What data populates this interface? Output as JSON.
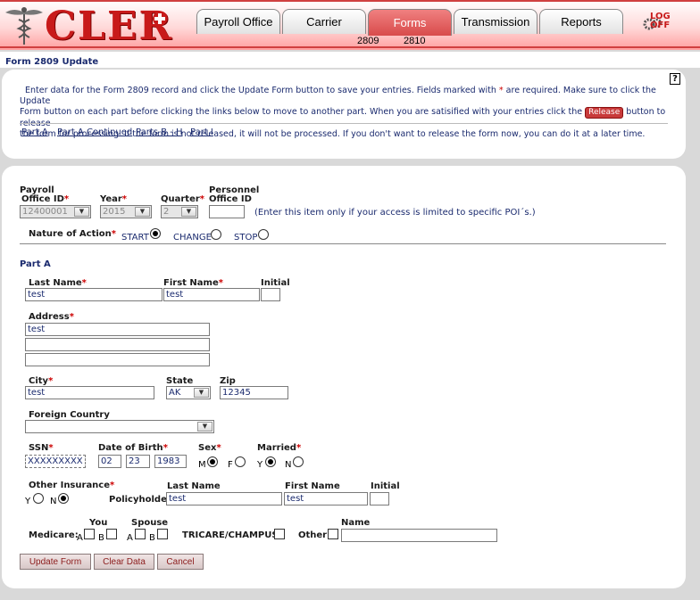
{
  "header": {
    "logo": "CLER",
    "tabs": [
      "Payroll Office",
      "Carrier",
      "Forms",
      "Transmission",
      "Reports"
    ],
    "active_tab": "Forms",
    "subtabs": [
      "2809",
      "2810"
    ],
    "logoff_line1": "LOG",
    "logoff_line2": "OFF"
  },
  "page_title": "Form 2809 Update",
  "instructions": {
    "text_1": "Enter data for the Form 2809 record and click the Update Form button to save your entries.  Fields marked with ",
    "req_mark": "*",
    "text_2": " are required.  Make sure to click the Update",
    "text_3": "Form button on each part before clicking the links below to move to another part.  When you are satisified with your entries click the ",
    "release_label": "Release",
    "text_4": " button to release",
    "text_5": "the form for processing.  If the form is not released, it will not be processed.  If you don't want to release the form now, you can do it at a later time.",
    "help_icon": "?"
  },
  "part_links": [
    "Part A",
    "Part A Continued",
    "Parts B - H",
    "Part I"
  ],
  "form": {
    "payroll_label": "Payroll",
    "office_id_label": "Office ID",
    "office_id_value": "12400001",
    "year_label": "Year",
    "year_value": "2015",
    "quarter_label": "Quarter",
    "quarter_value": "2",
    "personnel_label": "Personnel",
    "personnel_office_label": "Office ID",
    "personnel_value": "",
    "personnel_note": "(Enter this item only if your access is limited to specific POI´s.)",
    "nature_label": "Nature of Action",
    "nature_options": [
      "START",
      "CHANGE",
      "STOP"
    ],
    "nature_selected": "START",
    "part_a_title": "Part A",
    "last_name_label": "Last Name",
    "last_name_value": "test",
    "first_name_label": "First Name",
    "first_name_value": "test",
    "initial_label": "Initial",
    "initial_value": "",
    "address_label": "Address",
    "address_lines": [
      "test",
      "",
      ""
    ],
    "city_label": "City",
    "city_value": "test",
    "state_label": "State",
    "state_value": "AK",
    "zip_label": "Zip",
    "zip_value": "12345",
    "foreign_country_label": "Foreign Country",
    "foreign_country_value": "",
    "ssn_label": "SSN",
    "ssn_value": "XXXXXXXXX",
    "dob_label": "Date of Birth",
    "dob_month": "02",
    "dob_day": "23",
    "dob_year": "1983",
    "sex_label": "Sex",
    "sex_m": "M",
    "sex_f": "F",
    "sex_selected": "M",
    "married_label": "Married",
    "married_y": "Y",
    "married_n": "N",
    "married_selected": "Y",
    "other_ins_label": "Other Insurance",
    "other_ins_y": "Y",
    "other_ins_n": "N",
    "other_ins_selected": "N",
    "policyholder_label": "Policyholder",
    "ph_last_name_label": "Last Name",
    "ph_last_name_value": "test",
    "ph_first_name_label": "First Name",
    "ph_first_name_value": "test",
    "ph_initial_label": "Initial",
    "ph_initial_value": "",
    "you_label": "You",
    "spouse_label": "Spouse",
    "medicare_label": "Medicare:",
    "a_label": "A",
    "b_label": "B",
    "tricare_label": "TRICARE/CHAMPUS",
    "other_label": "Other",
    "name_label": "Name",
    "name_value": ""
  },
  "buttons": {
    "update": "Update Form",
    "clear": "Clear Data",
    "cancel": "Cancel"
  }
}
